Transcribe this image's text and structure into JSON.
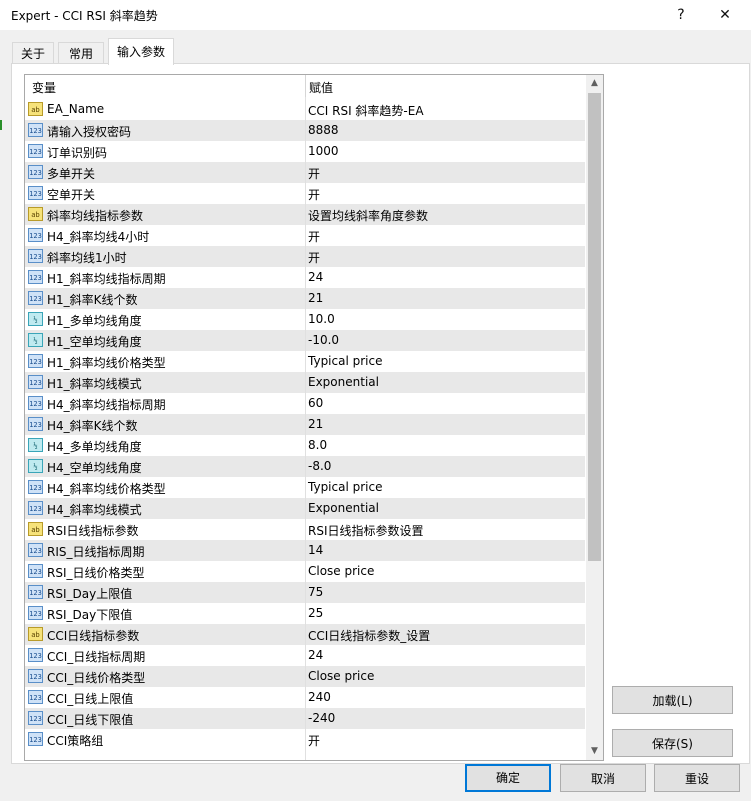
{
  "window": {
    "title": "Expert - CCI RSI 斜率趋势"
  },
  "titlebar": {
    "help": "?",
    "close": "✕"
  },
  "tabs": [
    {
      "label": "关于",
      "active": false
    },
    {
      "label": "常用",
      "active": false
    },
    {
      "label": "输入参数",
      "active": true
    }
  ],
  "grid": {
    "header": {
      "variable": "变量",
      "value": "赋值"
    },
    "rows": [
      {
        "type": "string",
        "icon": "ab",
        "name": "EA_Name",
        "value": "CCI RSI 斜率趋势-EA"
      },
      {
        "type": "int",
        "icon": "123",
        "name": "请输入授权密码",
        "value": "8888"
      },
      {
        "type": "int",
        "icon": "123",
        "name": "订单识别码",
        "value": "1000"
      },
      {
        "type": "int",
        "icon": "123",
        "name": "多单开关",
        "value": "开"
      },
      {
        "type": "int",
        "icon": "123",
        "name": "空单开关",
        "value": "开"
      },
      {
        "type": "string",
        "icon": "ab",
        "name": "斜率均线指标参数",
        "value": "设置均线斜率角度参数"
      },
      {
        "type": "int",
        "icon": "123",
        "name": "H4_斜率均线4小时",
        "value": "开"
      },
      {
        "type": "int",
        "icon": "123",
        "name": "斜率均线1小时",
        "value": "开"
      },
      {
        "type": "int",
        "icon": "123",
        "name": "H1_斜率均线指标周期",
        "value": "24"
      },
      {
        "type": "int",
        "icon": "123",
        "name": "H1_斜率K线个数",
        "value": "21"
      },
      {
        "type": "double",
        "icon": "½",
        "name": "H1_多单均线角度",
        "value": "10.0"
      },
      {
        "type": "double",
        "icon": "½",
        "name": "H1_空单均线角度",
        "value": "-10.0"
      },
      {
        "type": "int",
        "icon": "123",
        "name": "H1_斜率均线价格类型",
        "value": "Typical price"
      },
      {
        "type": "int",
        "icon": "123",
        "name": "H1_斜率均线模式",
        "value": "Exponential"
      },
      {
        "type": "int",
        "icon": "123",
        "name": "H4_斜率均线指标周期",
        "value": "60"
      },
      {
        "type": "int",
        "icon": "123",
        "name": "H4_斜率K线个数",
        "value": "21"
      },
      {
        "type": "double",
        "icon": "½",
        "name": "H4_多单均线角度",
        "value": "8.0"
      },
      {
        "type": "double",
        "icon": "½",
        "name": "H4_空单均线角度",
        "value": "-8.0"
      },
      {
        "type": "int",
        "icon": "123",
        "name": "H4_斜率均线价格类型",
        "value": "Typical price"
      },
      {
        "type": "int",
        "icon": "123",
        "name": "H4_斜率均线模式",
        "value": "Exponential"
      },
      {
        "type": "string",
        "icon": "ab",
        "name": "RSI日线指标参数",
        "value": "RSI日线指标参数设置"
      },
      {
        "type": "int",
        "icon": "123",
        "name": "RIS_日线指标周期",
        "value": "14"
      },
      {
        "type": "int",
        "icon": "123",
        "name": "RSI_日线价格类型",
        "value": "Close price"
      },
      {
        "type": "int",
        "icon": "123",
        "name": "RSI_Day上限值",
        "value": "75"
      },
      {
        "type": "int",
        "icon": "123",
        "name": "RSI_Day下限值",
        "value": "25"
      },
      {
        "type": "string",
        "icon": "ab",
        "name": "CCI日线指标参数",
        "value": "CCI日线指标参数_设置"
      },
      {
        "type": "int",
        "icon": "123",
        "name": "CCI_日线指标周期",
        "value": "24"
      },
      {
        "type": "int",
        "icon": "123",
        "name": "CCI_日线价格类型",
        "value": "Close price"
      },
      {
        "type": "int",
        "icon": "123",
        "name": "CCI_日线上限值",
        "value": "240"
      },
      {
        "type": "int",
        "icon": "123",
        "name": "CCI_日线下限值",
        "value": "-240"
      },
      {
        "type": "int",
        "icon": "123",
        "name": "CCI策略组",
        "value": "开"
      }
    ]
  },
  "side_buttons": {
    "load": "加载(L)",
    "save": "保存(S)"
  },
  "bottom_buttons": {
    "ok": "确定",
    "cancel": "取消",
    "reset": "重设"
  },
  "scrollbar": {
    "up": "▲",
    "down": "▼"
  },
  "colors": {
    "accent": "#0078d7",
    "row_alt": "#e8e8e8"
  }
}
